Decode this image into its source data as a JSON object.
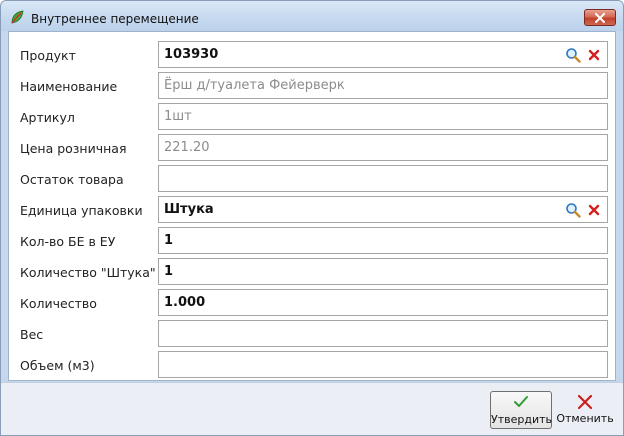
{
  "window": {
    "title": "Внутреннее перемещение",
    "icon": "leaf-icon",
    "close_icon": "close-icon"
  },
  "fields": [
    {
      "key": "product",
      "label": "Продукт",
      "value": "103930",
      "style": "bold",
      "lookup": true
    },
    {
      "key": "name",
      "label": "Наименование",
      "value": "Ёрш д/туалета Фейерверк",
      "style": "muted",
      "lookup": false
    },
    {
      "key": "article",
      "label": "Артикул",
      "value": "1шт",
      "style": "muted",
      "lookup": false
    },
    {
      "key": "retail_price",
      "label": "Цена розничная",
      "value": "221.20",
      "style": "muted",
      "lookup": false
    },
    {
      "key": "stock",
      "label": "Остаток товара",
      "value": "",
      "style": "bold",
      "lookup": false
    },
    {
      "key": "pack_unit",
      "label": "Единица упаковки",
      "value": "Штука",
      "style": "bold",
      "lookup": true
    },
    {
      "key": "base_units_per_pack",
      "label": "Кол-во БЕ в ЕУ",
      "value": "1",
      "style": "bold",
      "lookup": false
    },
    {
      "key": "qty_piece",
      "label": "Количество \"Штука\"",
      "value": "1",
      "style": "bold",
      "lookup": false
    },
    {
      "key": "qty",
      "label": "Количество",
      "value": "1.000",
      "style": "bold",
      "lookup": false
    },
    {
      "key": "weight",
      "label": "Вес",
      "value": "",
      "style": "bold",
      "lookup": false
    },
    {
      "key": "volume",
      "label": "Объем (м3)",
      "value": "",
      "style": "bold",
      "lookup": false
    }
  ],
  "footer": {
    "confirm_label": "Утвердить",
    "confirm_icon": "checkmark-icon",
    "cancel_label": "Отменить",
    "cancel_icon": "cross-icon"
  },
  "colors": {
    "accent_check": "#2e9e2e",
    "accent_cross": "#c81e1e",
    "title_bar": "#c6d9ef"
  }
}
